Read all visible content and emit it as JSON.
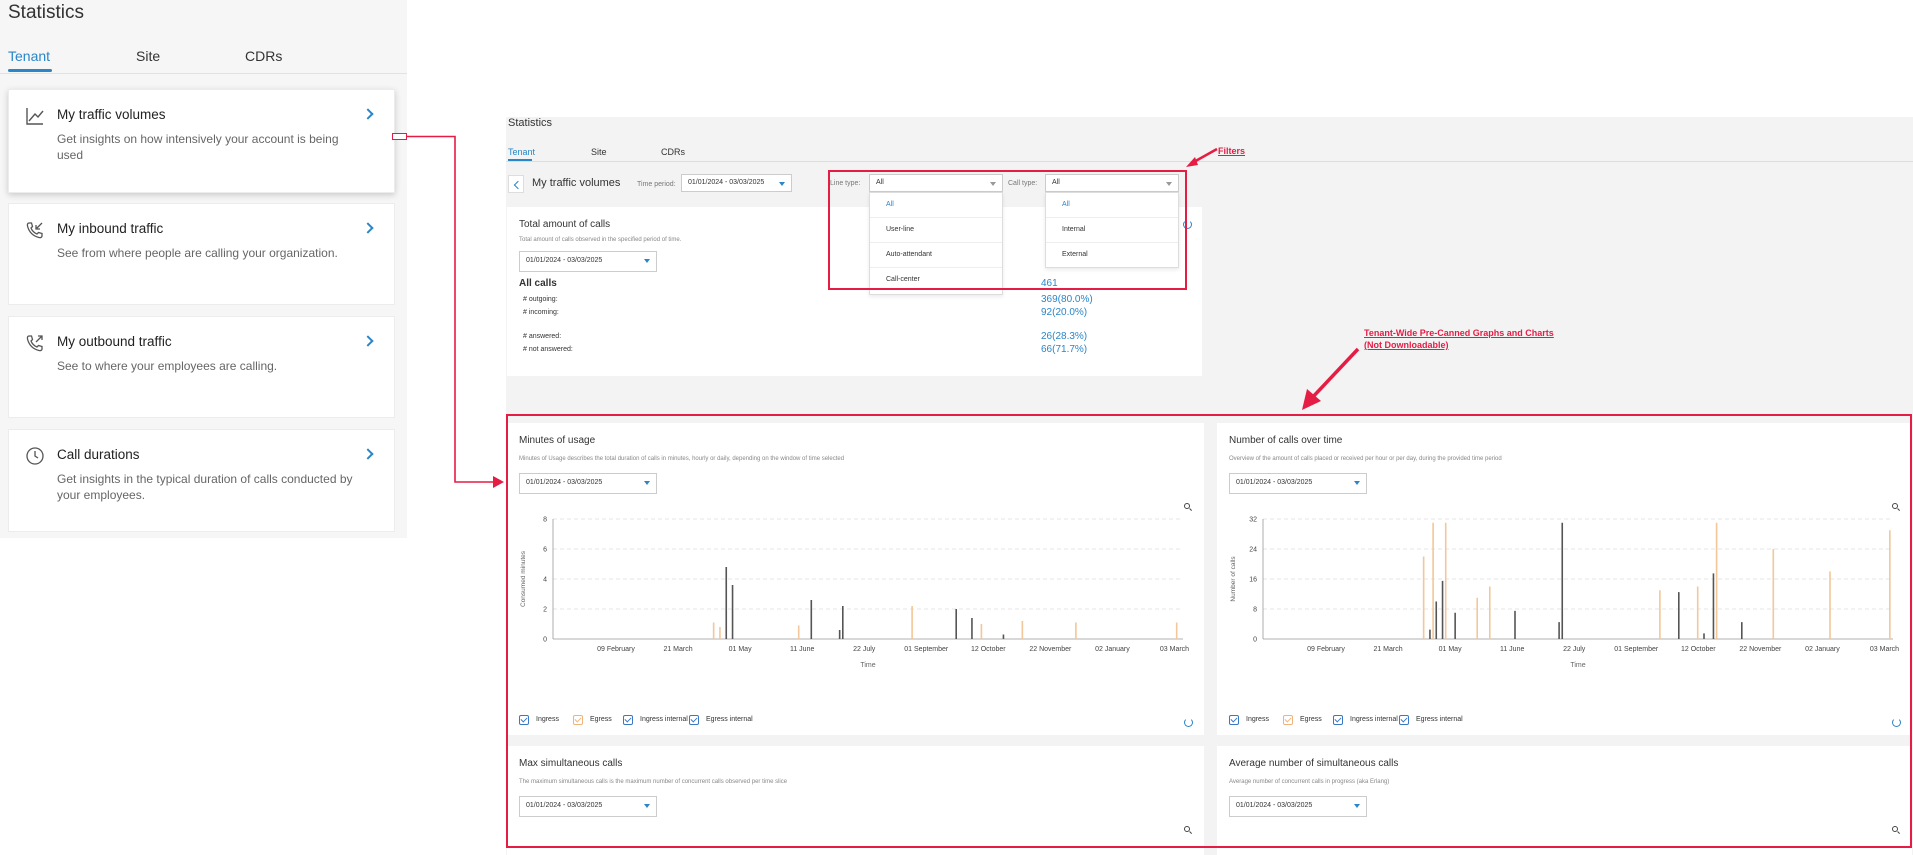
{
  "left": {
    "title": "Statistics",
    "tabs": [
      "Tenant",
      "Site",
      "CDRs"
    ],
    "cards": [
      {
        "title": "My traffic volumes",
        "desc": "Get insights on how intensively your account is being used",
        "icon": "line-chart-icon"
      },
      {
        "title": "My inbound traffic",
        "desc": "See from where people are calling your organization.",
        "icon": "incoming-call-icon"
      },
      {
        "title": "My outbound traffic",
        "desc": "See to where your employees are calling.",
        "icon": "outgoing-call-icon"
      },
      {
        "title": "Call durations",
        "desc": "Get insights in the typical duration of calls conducted by your employees.",
        "icon": "clock-icon"
      }
    ]
  },
  "right": {
    "title": "Statistics",
    "tabs": [
      "Tenant",
      "Site",
      "CDRs"
    ],
    "breadcrumb": "My traffic volumes",
    "filters": {
      "time_period_label": "Time period:",
      "time_period_value": "01/01/2024 - 03/03/2025",
      "line_type_label": "Line type:",
      "line_type_value": "All",
      "line_type_options": [
        "All",
        "User-line",
        "Auto-attendant",
        "Call-center"
      ],
      "call_type_label": "Call type:",
      "call_type_value": "All",
      "call_type_options": [
        "All",
        "Internal",
        "External"
      ]
    },
    "total_calls": {
      "title": "Total amount of calls",
      "desc": "Total amount of calls observed in the specified period of time.",
      "date": "01/01/2024 - 03/03/2025",
      "all_calls_label": "All calls",
      "all_calls_value": "461",
      "outgoing_label": "# outgoing:",
      "outgoing_value": "369(80.0%)",
      "incoming_label": "# incoming:",
      "incoming_value": "92(20.0%)",
      "answered_label": "# answered:",
      "answered_value": "26(28.3%)",
      "not_answered_label": "# not answered:",
      "not_answered_value": "66(71.7%)"
    },
    "annotations": {
      "filters": "Filters",
      "tenant_wide_1": "Tenant-Wide Pre-Canned Graphs and Charts",
      "tenant_wide_2": "(Not Downloadable)"
    },
    "minutes_panel": {
      "title": "Minutes of usage",
      "desc": "Minutes of Usage describes the total duration of calls in minutes, hourly or daily, depending on the window of time selected",
      "date": "01/01/2024 - 03/03/2025"
    },
    "calls_panel": {
      "title": "Number of calls over time",
      "desc": "Overview of the amount of calls placed or received per hour or per day, during the provided time period",
      "date": "01/01/2024 - 03/03/2025"
    },
    "max_panel": {
      "title": "Max simultaneous calls",
      "desc": "The maximum simultaneous calls is the maximum number of concurrent calls observed per time slice",
      "date": "01/01/2024 - 03/03/2025"
    },
    "avg_panel": {
      "title": "Average number of simultaneous calls",
      "desc": "Average number of concurrent calls in progress (aka Erlang)",
      "date": "01/01/2024 - 03/03/2025"
    },
    "legend": [
      {
        "label": "Ingress",
        "color": "#3a78c2"
      },
      {
        "label": "Egress",
        "color": "#f0b37a"
      },
      {
        "label": "Ingress internal",
        "color": "#3a78c2"
      },
      {
        "label": "Egress internal",
        "color": "#3a78c2"
      }
    ]
  },
  "chart_data": [
    {
      "type": "bar",
      "title": "Minutes of usage",
      "xlabel": "Time",
      "ylabel": "Consumed minutes",
      "ylim": [
        0,
        8
      ],
      "yticks": [
        0,
        2,
        4,
        6,
        8
      ],
      "xticks": [
        "09 February",
        "21 March",
        "01 May",
        "11 June",
        "22 July",
        "01 September",
        "12 October",
        "22 November",
        "02 January",
        "03 March"
      ],
      "grid": true,
      "series": [
        {
          "name": "Ingress",
          "color": "#555555",
          "points": [
            [
              0.275,
              4.8
            ],
            [
              0.285,
              3.6
            ],
            [
              0.41,
              2.6
            ],
            [
              0.455,
              0.6
            ],
            [
              0.46,
              2.2
            ],
            [
              0.64,
              2.0
            ],
            [
              0.665,
              1.4
            ],
            [
              0.715,
              0.3
            ]
          ]
        },
        {
          "name": "Egress",
          "color": "#f2c79a",
          "points": [
            [
              0.255,
              1.1
            ],
            [
              0.265,
              0.8
            ],
            [
              0.39,
              0.9
            ],
            [
              0.57,
              2.2
            ],
            [
              0.68,
              1.0
            ],
            [
              0.745,
              1.2
            ],
            [
              0.83,
              1.1
            ],
            [
              0.99,
              1.1
            ]
          ]
        }
      ]
    },
    {
      "type": "bar",
      "title": "Number of calls over time",
      "xlabel": "Time",
      "ylabel": "Number of calls",
      "ylim": [
        0,
        32
      ],
      "yticks": [
        0,
        8,
        16,
        24,
        32
      ],
      "xticks": [
        "09 February",
        "21 March",
        "01 May",
        "11 June",
        "22 July",
        "01 September",
        "12 October",
        "22 November",
        "02 January",
        "03 March"
      ],
      "grid": true,
      "series": [
        {
          "name": "Ingress",
          "color": "#555555",
          "points": [
            [
              0.265,
              2.5
            ],
            [
              0.275,
              10.0
            ],
            [
              0.285,
              15.5
            ],
            [
              0.305,
              7.0
            ],
            [
              0.4,
              7.5
            ],
            [
              0.47,
              4.5
            ],
            [
              0.475,
              31.0
            ],
            [
              0.66,
              12.5
            ],
            [
              0.7,
              1.5
            ],
            [
              0.715,
              17.5
            ],
            [
              0.76,
              4.5
            ]
          ]
        },
        {
          "name": "Egress",
          "color": "#f2c79a",
          "points": [
            [
              0.255,
              22.0
            ],
            [
              0.27,
              31.0
            ],
            [
              0.29,
              31.0
            ],
            [
              0.34,
              11.0
            ],
            [
              0.36,
              14.0
            ],
            [
              0.63,
              13.0
            ],
            [
              0.69,
              14.0
            ],
            [
              0.72,
              31.0
            ],
            [
              0.81,
              24.0
            ],
            [
              0.9,
              18.0
            ],
            [
              0.995,
              29.0
            ]
          ]
        }
      ]
    }
  ]
}
